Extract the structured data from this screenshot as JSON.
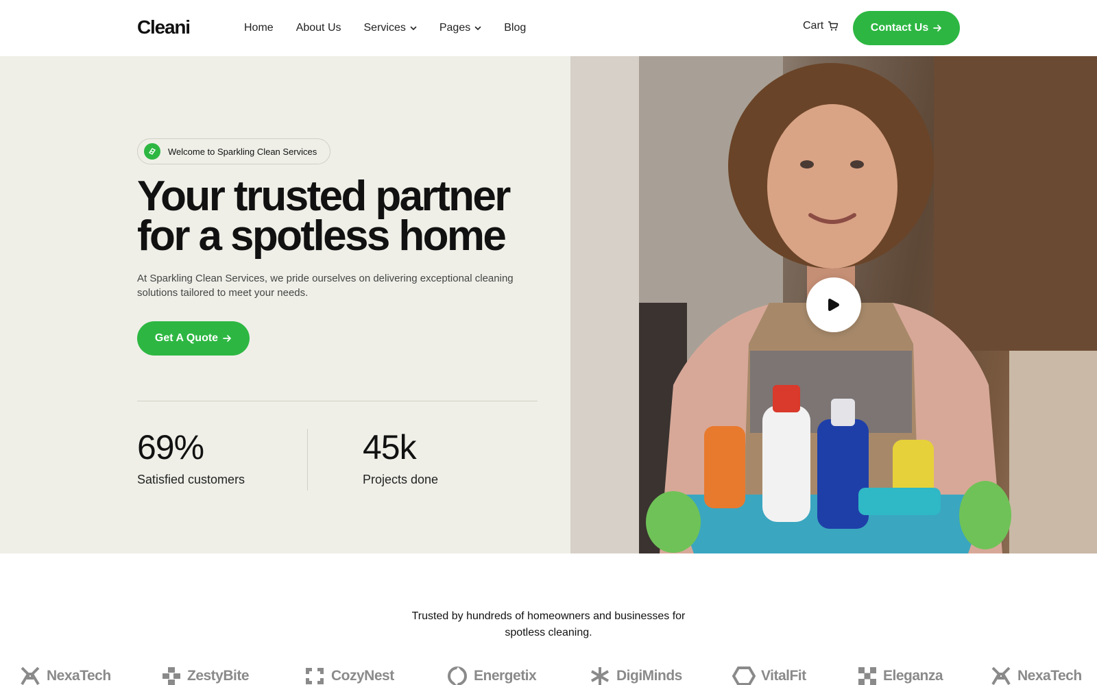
{
  "header": {
    "logo": "Cleani",
    "nav": [
      {
        "label": "Home",
        "dropdown": false
      },
      {
        "label": "About Us",
        "dropdown": false
      },
      {
        "label": "Services",
        "dropdown": true
      },
      {
        "label": "Pages",
        "dropdown": true
      },
      {
        "label": "Blog",
        "dropdown": false
      }
    ],
    "cart_label": "Cart",
    "contact_label": "Contact Us"
  },
  "hero": {
    "badge": "Welcome to Sparkling Clean Services",
    "title_line1": "Your trusted partner",
    "title_line2": "for a spotless home",
    "description": "At Sparkling Clean Services, we pride ourselves on delivering exceptional cleaning solutions tailored to meet your needs.",
    "cta_label": "Get A Quote",
    "stats": [
      {
        "value": "69%",
        "label": "Satisfied customers"
      },
      {
        "value": "45k",
        "label": "Projects done"
      }
    ]
  },
  "trusted": {
    "text": "Trusted by hundreds of homeowners and businesses for spotless cleaning.",
    "brands": [
      "NexaTech",
      "ZestyBite",
      "CozyNest",
      "Energetix",
      "DigiMinds",
      "VitalFit",
      "Eleganza",
      "NexaTech"
    ]
  },
  "colors": {
    "accent": "#2db742",
    "hero_bg": "#efefe8",
    "brand_gray": "#8a8a8a"
  }
}
